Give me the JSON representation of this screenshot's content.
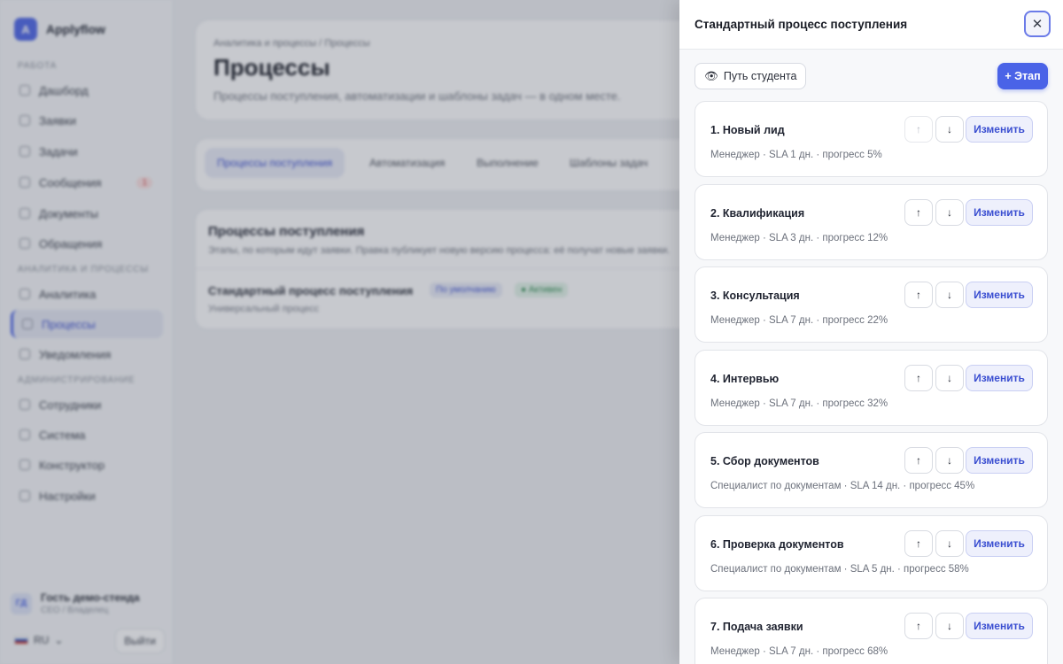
{
  "app": {
    "logo_letter": "A",
    "name": "Applyflow"
  },
  "sidebar": {
    "sections": [
      {
        "label": "Работа"
      },
      {
        "label": "Аналитика и процессы"
      },
      {
        "label": "Администрирование"
      }
    ],
    "items": [
      {
        "label": "Дашборд"
      },
      {
        "label": "Заявки"
      },
      {
        "label": "Задачи"
      },
      {
        "label": "Сообщения",
        "badge": "1"
      },
      {
        "label": "Документы"
      },
      {
        "label": "Обращения"
      },
      {
        "label": "Аналитика"
      },
      {
        "label": "Процессы"
      },
      {
        "label": "Уведомления"
      },
      {
        "label": "Сотрудники"
      },
      {
        "label": "Система"
      },
      {
        "label": "Конструктор"
      },
      {
        "label": "Настройки"
      }
    ],
    "user": {
      "initials": "ГД",
      "name": "Гость демо-стенда",
      "role": "CEO / Владелец"
    },
    "lang": "RU",
    "logout": "Выйти"
  },
  "main": {
    "breadcrumb": "Аналитика и процессы / Процессы",
    "title": "Процессы",
    "subtitle": "Процессы поступления, автоматизации и шаблоны задач — в одном месте.",
    "tabs": [
      "Процессы поступления",
      "Автоматизация",
      "Выполнение",
      "Шаблоны задач"
    ],
    "list": {
      "title": "Процессы поступления",
      "subtitle": "Этапы, по которым идут заявки. Правка публикует новую версию процесса: её получат новые заявки.",
      "row": {
        "title": "Стандартный процесс поступления",
        "chip_default": "По умолчанию",
        "chip_active": "● Активен",
        "sub": "Универсальный процесс"
      }
    }
  },
  "drawer": {
    "title": "Стандартный процесс поступления",
    "close_glyph": "✕",
    "path_icon": "👁",
    "path_label": "Путь студента",
    "add_label": "+ Этап",
    "up_glyph": "↑",
    "down_glyph": "↓",
    "edit_label": "Изменить",
    "stages": [
      {
        "title": "1. Новый лид",
        "meta": "Менеджер · SLA 1 дн. · прогресс 5%",
        "up_disabled": true
      },
      {
        "title": "2. Квалификация",
        "meta": "Менеджер · SLA 3 дн. · прогресс 12%"
      },
      {
        "title": "3. Консультация",
        "meta": "Менеджер · SLA 7 дн. · прогресс 22%"
      },
      {
        "title": "4. Интервью",
        "meta": "Менеджер · SLA 7 дн. · прогресс 32%"
      },
      {
        "title": "5. Сбор документов",
        "meta": "Специалист по документам · SLA 14 дн. · прогресс 45%"
      },
      {
        "title": "6. Проверка документов",
        "meta": "Специалист по документам · SLA 5 дн. · прогресс 58%"
      },
      {
        "title": "7. Подача заявки",
        "meta": "Менеджер · SLA 7 дн. · прогресс 68%"
      }
    ]
  }
}
